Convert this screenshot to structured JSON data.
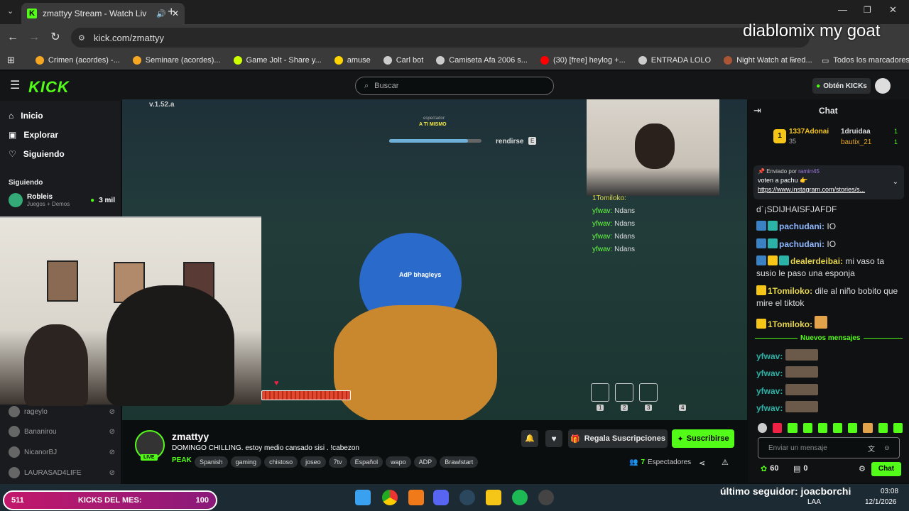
{
  "browser": {
    "tab_title": "zmattyy Stream - Watch Liv",
    "url": "kick.com/zmattyy",
    "bookmarks": [
      {
        "label": "Crimen (acordes) -...",
        "color": "#f5a623"
      },
      {
        "label": "Seminare (acordes)...",
        "color": "#f5a623"
      },
      {
        "label": "Game Jolt - Share y...",
        "color": "#ccff00"
      },
      {
        "label": "amuse",
        "color": "#ffd400"
      },
      {
        "label": "Carl bot",
        "color": "#cccccc"
      },
      {
        "label": "Camiseta Afa 2006 s...",
        "color": "#cccccc"
      },
      {
        "label": "(30) [free] heylog +...",
        "color": "#ff0000"
      },
      {
        "label": "ENTRADA LOLO",
        "color": "#cccccc"
      },
      {
        "label": "Night Watch at Fred...",
        "color": "#aa5533"
      }
    ],
    "all_bookmarks": "Todos los marcadores"
  },
  "overlay_top_text": "diablomix my goat",
  "kick": {
    "search_placeholder": "Buscar",
    "get_kicks": "Obtén KICKs",
    "nav": {
      "home": "Inicio",
      "explore": "Explorar",
      "following": "Siguiendo"
    },
    "following_heading": "Siguiendo",
    "followed": [
      {
        "name": "Robleis",
        "sub": "Juegos + Demos",
        "viewers": "3 mil"
      }
    ],
    "offline_channels": [
      "rageylo",
      "Bananirou",
      "NicanorBJ",
      "LAURASAD4LIFE"
    ]
  },
  "video": {
    "version": "v.1.52.a",
    "spectator_label": "espectador:",
    "spectating": "A TI MISMO",
    "surrender": "rendirse",
    "surrender_key": "E",
    "player_name": "AdP bhagleys",
    "slots": [
      "1",
      "2",
      "3",
      "4"
    ],
    "chat_overlay": [
      {
        "user": "1Tomiloko:",
        "text": ""
      },
      {
        "user": "yfwav:",
        "text": "Ndans"
      },
      {
        "user": "yfwav:",
        "text": "Ndans"
      },
      {
        "user": "yfwav:",
        "text": "Ndans"
      },
      {
        "user": "yfwav:",
        "text": "Ndans"
      }
    ]
  },
  "stream": {
    "channel": "zmattyy",
    "live": "LIVE",
    "title": "DOMINGO CHILLING. estoy medio cansado sisi . !cabezon",
    "peak": "PEAK",
    "tags": [
      "Spanish",
      "gaming",
      "chistoso",
      "joseo",
      "7tv",
      "Español",
      "wapo",
      "ADP",
      "Brawlstart"
    ],
    "gift_subs": "Regala Suscripciones",
    "subscribe": "Suscribirse",
    "viewers": "7",
    "viewers_label": "Espectadores"
  },
  "chat": {
    "title": "Chat",
    "leaderboard": [
      {
        "name": "1337Adonai",
        "count": "35"
      },
      {
        "name": "1druidaa",
        "count": "1"
      },
      {
        "name": "bautix_21",
        "count": "1"
      }
    ],
    "pinned_by_label": "Enviado por",
    "pinned_by": "ramirr45",
    "pinned_text": "voten a pachu 👉",
    "pinned_link": "https://www.instagram.com/stories/s...",
    "messages": [
      {
        "user": "",
        "text": "d`¡SDIJHAISFJAFDF",
        "color": "#dddddd"
      },
      {
        "user": "pachudani:",
        "text": "IO",
        "color": "#8fb8ff"
      },
      {
        "user": "pachudani:",
        "text": "IO",
        "color": "#8fb8ff"
      },
      {
        "user": "dealerdeibai:",
        "text": "mi vaso ta susio le paso una esponja",
        "color": "#e6d44a"
      },
      {
        "user": "1Tomiloko:",
        "text": "dile al niño bobito que mire el tiktok",
        "color": "#e6d44a"
      },
      {
        "user": "1Tomiloko:",
        "text": "",
        "color": "#e6d44a"
      }
    ],
    "new_messages": "Nuevos mensajes",
    "recent": [
      "yfwav:",
      "yfwav:",
      "yfwav:",
      "yfwav:"
    ],
    "input_placeholder": "Enviar un mensaje",
    "points": "60",
    "gifts": "0",
    "send": "Chat"
  },
  "overlay_bottom": {
    "kicks_count": "511",
    "kicks_label": "KICKS DEL MES:",
    "kicks_goal": "100",
    "last_follower": "último seguidor: joacborchi"
  },
  "taskbar": {
    "lang": "LAA",
    "time": "03:08",
    "date": "12/1/2026"
  }
}
